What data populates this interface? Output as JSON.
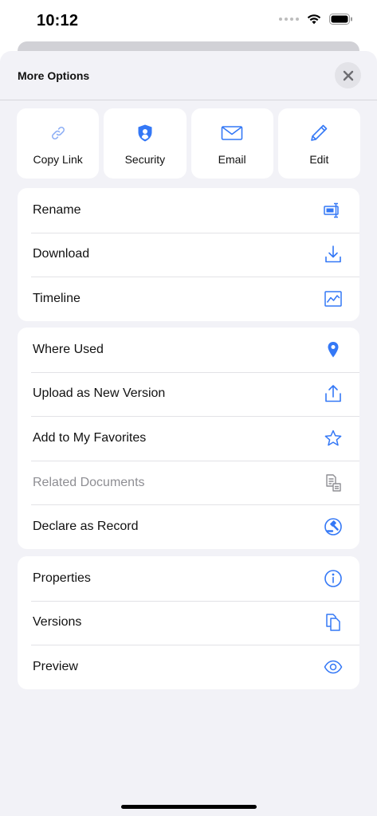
{
  "status_bar": {
    "time": "10:12"
  },
  "sheet": {
    "title": "More Options",
    "close_icon": "close-icon"
  },
  "quick_actions": [
    {
      "label": "Copy Link",
      "icon": "link-icon"
    },
    {
      "label": "Security",
      "icon": "shield-icon"
    },
    {
      "label": "Email",
      "icon": "envelope-icon"
    },
    {
      "label": "Edit",
      "icon": "pencil-icon"
    }
  ],
  "groups": [
    {
      "items": [
        {
          "label": "Rename",
          "icon": "rename-icon",
          "enabled": true
        },
        {
          "label": "Download",
          "icon": "download-icon",
          "enabled": true
        },
        {
          "label": "Timeline",
          "icon": "timeline-icon",
          "enabled": true
        }
      ]
    },
    {
      "items": [
        {
          "label": "Where Used",
          "icon": "location-pin-icon",
          "enabled": true
        },
        {
          "label": "Upload as New Version",
          "icon": "upload-icon",
          "enabled": true
        },
        {
          "label": "Add to My Favorites",
          "icon": "star-icon",
          "enabled": true
        },
        {
          "label": "Related Documents",
          "icon": "related-documents-icon",
          "enabled": false
        },
        {
          "label": "Declare as Record",
          "icon": "gavel-icon",
          "enabled": true
        }
      ]
    },
    {
      "items": [
        {
          "label": "Properties",
          "icon": "info-icon",
          "enabled": true
        },
        {
          "label": "Versions",
          "icon": "versions-icon",
          "enabled": true
        },
        {
          "label": "Preview",
          "icon": "eye-icon",
          "enabled": true
        }
      ]
    }
  ],
  "colors": {
    "accent": "#3478f6",
    "disabled": "#8e8e93",
    "background": "#f2f2f7"
  }
}
